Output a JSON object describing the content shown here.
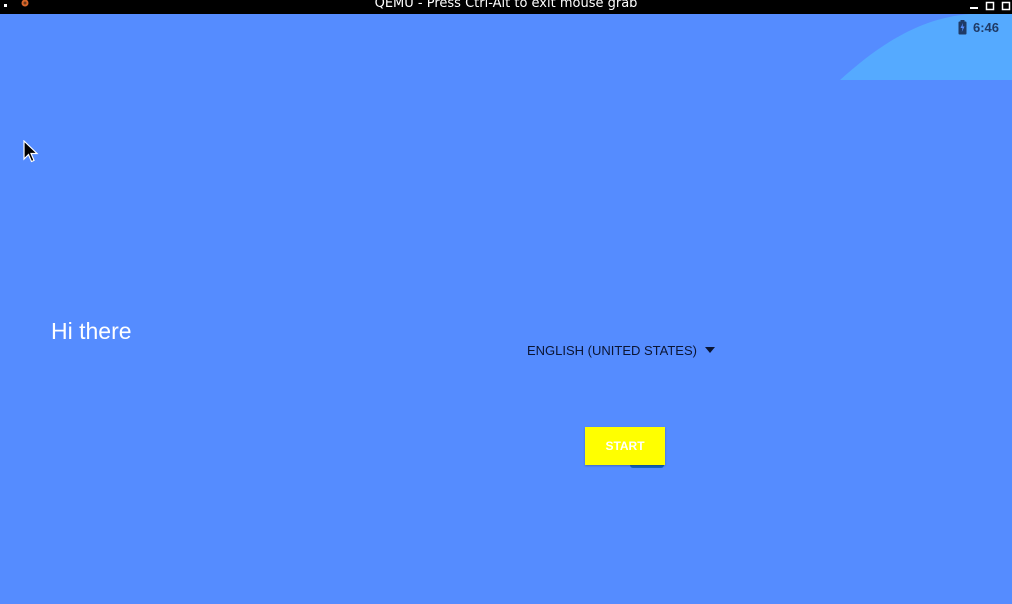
{
  "window": {
    "title": "QEMU - Press Ctrl-Alt to exit mouse grab"
  },
  "status_bar": {
    "time": "6:46",
    "icons": [
      "battery-charging-icon"
    ]
  },
  "welcome": {
    "greeting": "Hi there",
    "language": "ENGLISH (UNITED STATES)",
    "start_label": "START"
  },
  "colors": {
    "background": "#558cff",
    "accent_shape": "#55aaff",
    "start_button": "#ffff00",
    "titlebar": "#000000"
  }
}
